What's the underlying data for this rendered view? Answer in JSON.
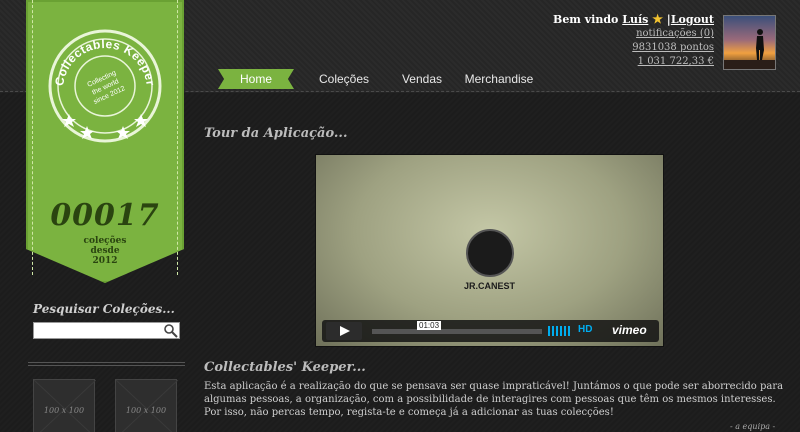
{
  "brand": {
    "stamp_title": "Collectables Keeper",
    "stamp_tagline_line1": "Collecting",
    "stamp_tagline_line2": "the world",
    "stamp_tagline_line3": "since 2012",
    "collection_count": "00017",
    "caption_line1": "coleções",
    "caption_line2": "desde",
    "caption_line3": "2012"
  },
  "nav": {
    "items": [
      {
        "label": "Home",
        "active": true
      },
      {
        "label": "Coleções"
      },
      {
        "label": "Vendas"
      },
      {
        "label": "Merchandise"
      }
    ]
  },
  "user": {
    "welcome": "Bem vindo",
    "name": "Luís",
    "separator": "|",
    "logout": "Logout",
    "notifications": "notificações (0)",
    "points": "9831038 pontos",
    "balance": "1 031 722,33 €"
  },
  "sidebar": {
    "search_title": "Pesquisar Coleções...",
    "search_placeholder": "",
    "thumbs": [
      "100 x 100",
      "100 x 100"
    ]
  },
  "main": {
    "tour_title": "Tour da Aplicação...",
    "video": {
      "brand": "JR.CANEST",
      "timecode": "01:03",
      "hd": "HD",
      "provider": "vimeo"
    },
    "about_title": "Collectables' Keeper...",
    "description": "Esta aplicação é a realização do que se pensava ser quase impraticável! Juntámos o que pode ser aborrecido para algumas pessoas, a organização, com a possibilidade de interagires com pessoas que têm os mesmos interesses. Por isso, não percas tempo, regista-te e começa já a adicionar as tuas colecções!",
    "signature": "- a equipa -"
  },
  "colors": {
    "accent": "#7bb340",
    "background": "#232323",
    "video_accent": "#00adef"
  }
}
